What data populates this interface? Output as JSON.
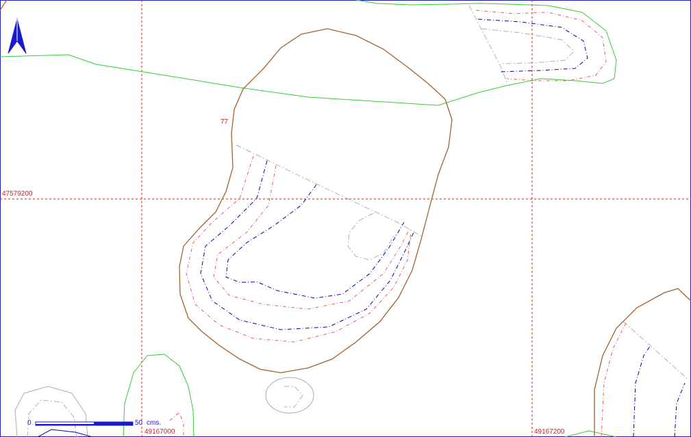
{
  "map": {
    "grid": {
      "northing_label": "47579200",
      "easting_labels": [
        "49167000",
        "49167200"
      ],
      "color": "#cc2222"
    },
    "spot_label": "77",
    "scale_bar": {
      "start_label": "0",
      "end_label": "50",
      "unit_label": "cms."
    },
    "north_arrow": {
      "icon": "north-arrow-icon",
      "color": "#1a1acc"
    },
    "colors": {
      "border": "#1a1acc",
      "outline": "#a0622d",
      "green_line": "#33cc33",
      "red_dashed": "#e06060",
      "blue_dashed": "#0000aa",
      "gray": "#aaaaaa",
      "grid": "#cc2222"
    }
  }
}
